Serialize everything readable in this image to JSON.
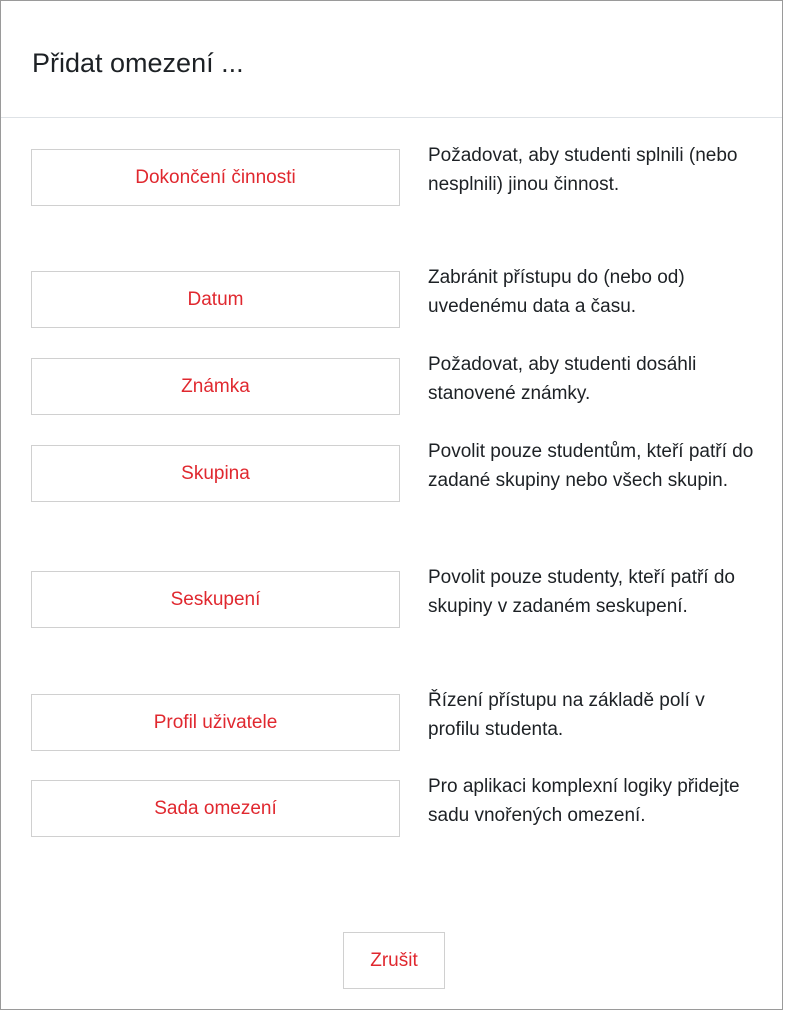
{
  "dialog": {
    "title": "Přidat omezení ..."
  },
  "options": [
    {
      "label": "Dokončení činnosti",
      "description": "Požadovat, aby studenti splnili (nebo nesplnili) jinou činnost."
    },
    {
      "label": "Datum",
      "description": "Zabránit přístupu do (nebo od) uvedenému data a času."
    },
    {
      "label": "Známka",
      "description": "Požadovat, aby studenti dosáhli stanovené známky."
    },
    {
      "label": "Skupina",
      "description": "Povolit pouze studentům, kteří patří do zadané skupiny nebo všech skupin."
    },
    {
      "label": "Seskupení",
      "description": "Povolit pouze studenty, kteří patří do skupiny v zadaném seskupení."
    },
    {
      "label": "Profil uživatele",
      "description": "Řízení přístupu na základě polí v profilu studenta."
    },
    {
      "label": "Sada omezení",
      "description": "Pro aplikaci komplexní logiky přidejte sadu vnořených omezení."
    }
  ],
  "footer": {
    "cancel_label": "Zrušit"
  },
  "colors": {
    "link_red": "#e0282f",
    "text": "#1d2125",
    "border": "#d0d0d0"
  }
}
